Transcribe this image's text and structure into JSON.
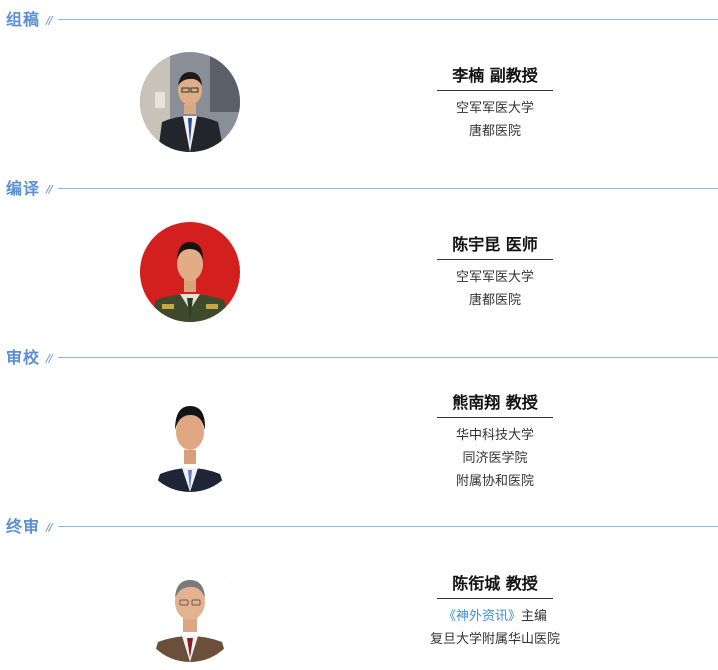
{
  "sections": [
    {
      "title": "组稿",
      "slashes": "//",
      "person": {
        "name": "李楠 副教授",
        "line1": "空军军医大学",
        "line2": "唐都医院",
        "avatar": "portrait-photo-man-glasses-dark-suit"
      }
    },
    {
      "title": "编译",
      "slashes": "//",
      "person": {
        "name": "陈宇昆 医师",
        "line1": "空军军医大学",
        "line2": "唐都医院",
        "avatar": "portrait-photo-man-military-uniform-red-background"
      }
    },
    {
      "title": "审校",
      "slashes": "//",
      "person": {
        "name": "熊南翔 教授",
        "line1": "华中科技大学",
        "line2": "同济医学院",
        "line3": "附属协和医院",
        "avatar": "portrait-photo-man-suit-white-background"
      }
    },
    {
      "title": "终审",
      "slashes": "//",
      "person": {
        "name": "陈衔城 教授",
        "journal": "《神外资讯》",
        "role": "主编",
        "line2": "复旦大学附属华山医院",
        "avatar": "portrait-photo-older-man-glasses-suit"
      }
    }
  ],
  "colors": {
    "accent": "#5b8fd6",
    "rule": "#8fb1e6",
    "journal": "#3a8fd6"
  }
}
